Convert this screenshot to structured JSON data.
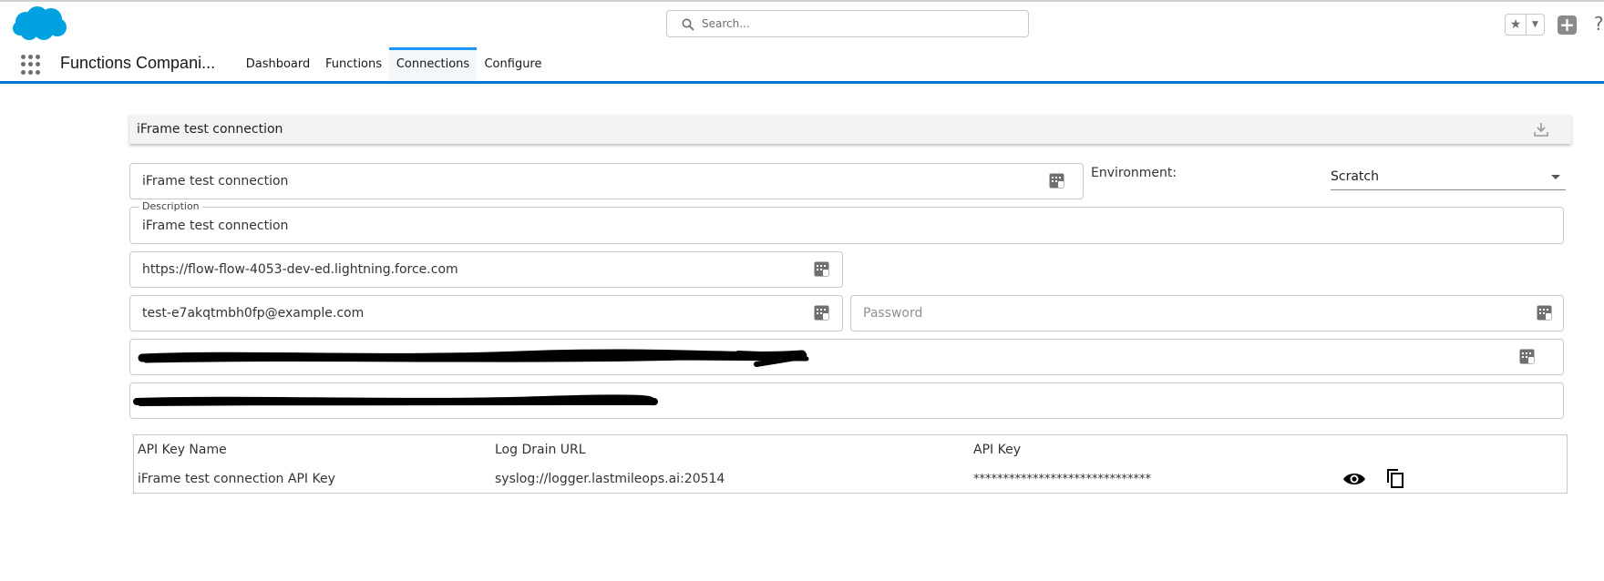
{
  "header": {
    "search_placeholder": "Search...",
    "app_name": "Functions Compani...",
    "tabs": [
      {
        "label": "Dashboard"
      },
      {
        "label": "Functions"
      },
      {
        "label": "Connections"
      },
      {
        "label": "Configure"
      }
    ],
    "active_tab": "Connections",
    "brand_color": "#0176d3",
    "logo_color": "#00a1e0"
  },
  "card": {
    "title": "iFrame test connection"
  },
  "form": {
    "name_value": "iFrame test connection",
    "environment_label": "Environment:",
    "environment_value": "Scratch",
    "description_label": "Description",
    "description_value": "iFrame test connection",
    "url_value": "https://flow-flow-4053-dev-ed.lightning.force.com",
    "username_value": "test-e7akqtmbh0fp@example.com",
    "password_placeholder": "Password"
  },
  "table": {
    "headers": [
      "API Key Name",
      "Log Drain URL",
      "API Key"
    ],
    "rows": [
      {
        "name": "iFrame test connection API Key",
        "log_drain_url": "syslog://logger.lastmileops.ai:20514",
        "api_key": "******************************"
      }
    ]
  }
}
